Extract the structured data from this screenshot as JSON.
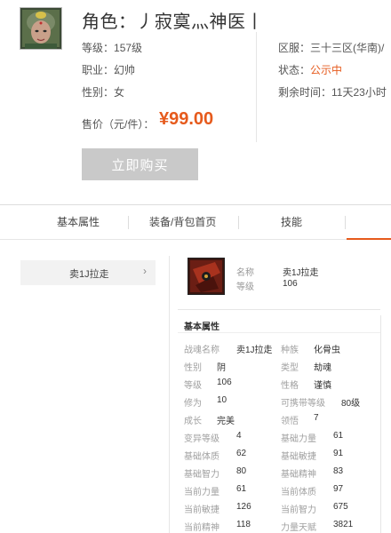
{
  "header": {
    "title": "角色：丿寂寞灬神医丨",
    "left_info": [
      {
        "label": "等级：",
        "value": "157级"
      },
      {
        "label": "职业：",
        "value": "幻帅"
      },
      {
        "label": "性别：",
        "value": "女"
      }
    ],
    "right_info": [
      {
        "label": "区服：",
        "value": "三十三区(华南)/",
        "color": ""
      },
      {
        "label": "状态：",
        "value": "公示中",
        "color": "red"
      },
      {
        "label": "剩余时间：",
        "value": "11天23小时"
      }
    ],
    "price_label": "售价（元/件）：",
    "price_value": "¥99.00",
    "buy_button": "立即购买"
  },
  "tabs": [
    {
      "label": "基本属性"
    },
    {
      "label": "装备/背包首页"
    },
    {
      "label": "技能"
    }
  ],
  "side": {
    "items": [
      {
        "label": "卖1J拉走",
        "chevron": "›"
      }
    ]
  },
  "pet": {
    "name_label": "名称",
    "name_value": "卖1J拉走",
    "level_label": "等级",
    "level_value": "106"
  },
  "section_title": "基本属性",
  "attributes": {
    "left": [
      {
        "k": "战魂名称",
        "v": "卖1J拉走"
      },
      {
        "k": "性别",
        "v": "阴"
      },
      {
        "k": "等级",
        "v": "106"
      },
      {
        "k": "修为",
        "v": "10"
      },
      {
        "k": "成长",
        "v": "完美"
      },
      {
        "k": "变异等级",
        "v": "4"
      },
      {
        "k": "基础体质",
        "v": "62"
      },
      {
        "k": "基础智力",
        "v": "80"
      },
      {
        "k": "当前力量",
        "v": "61"
      },
      {
        "k": "当前敏捷",
        "v": "126"
      },
      {
        "k": "当前精神",
        "v": "118"
      }
    ],
    "right": [
      {
        "k": "种族",
        "v": "化骨虫"
      },
      {
        "k": "类型",
        "v": "劫魂"
      },
      {
        "k": "性格",
        "v": "谨慎"
      },
      {
        "k": "可携带等级",
        "v": "80级"
      },
      {
        "k": "领悟",
        "v": "7"
      },
      {
        "k": "基础力量",
        "v": "61"
      },
      {
        "k": "基础敏捷",
        "v": "91"
      },
      {
        "k": "基础精神",
        "v": "83"
      },
      {
        "k": "当前体质",
        "v": "97"
      },
      {
        "k": "当前智力",
        "v": "675"
      },
      {
        "k": "力量天赋",
        "v": "3821"
      }
    ]
  },
  "colors": {
    "accent": "#e65a1c",
    "button_bg": "#c9c9c9"
  }
}
